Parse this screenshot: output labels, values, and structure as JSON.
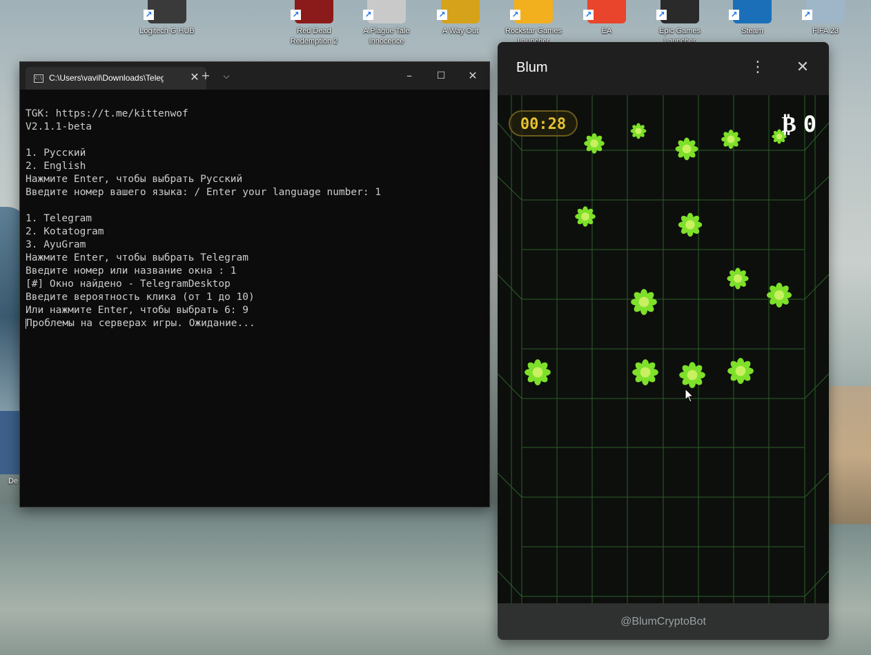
{
  "desktop": {
    "icons": [
      {
        "label": "Logitech G HUB",
        "color": "#3a3a3a"
      },
      {
        "label": "Red Dead Redemption 2",
        "color": "#8b1a1a"
      },
      {
        "label": "A Plague Tale Innocence",
        "color": "#c9c9c9"
      },
      {
        "label": "A Way Out",
        "color": "#d6a21a"
      },
      {
        "label": "Rockstar Games Launcher",
        "color": "#f2b01e"
      },
      {
        "label": "EA",
        "color": "#e8452c"
      },
      {
        "label": "Epic Games Launcher",
        "color": "#2a2a2a"
      },
      {
        "label": "Steam",
        "color": "#1b6fb8"
      },
      {
        "label": "FIFA 23",
        "color": "#9fb6c8"
      }
    ],
    "side_label": "De"
  },
  "terminal": {
    "tab_title": "C:\\Users\\vavil\\Downloads\\Telegram",
    "lines": [
      "TGK: https://t.me/kittenwof",
      "V2.1.1-beta",
      "",
      "1. Русский",
      "2. English",
      "Нажмите Enter, чтобы выбрать Русский",
      "Введите номер вашего языка: / Enter your language number: 1",
      "",
      "1. Telegram",
      "2. Kotatogram",
      "3. AyuGram",
      "Нажмите Enter, чтобы выбрать Telegram",
      "Введите номер или название окна : 1",
      "[#] Окно найдено - TelegramDesktop",
      "Введите вероятность клика (от 1 до 10)",
      "Или нажмите Enter, чтобы выбрать 6: 9",
      "Проблемы на серверах игры. Ожидание..."
    ]
  },
  "blum": {
    "title": "Blum",
    "timer": "00:28",
    "score_symbol": "₿",
    "score": "0",
    "footer": "@BlumCryptoBot",
    "accent_green": "#7ee02a",
    "grid_color": "#2f6a2a"
  }
}
